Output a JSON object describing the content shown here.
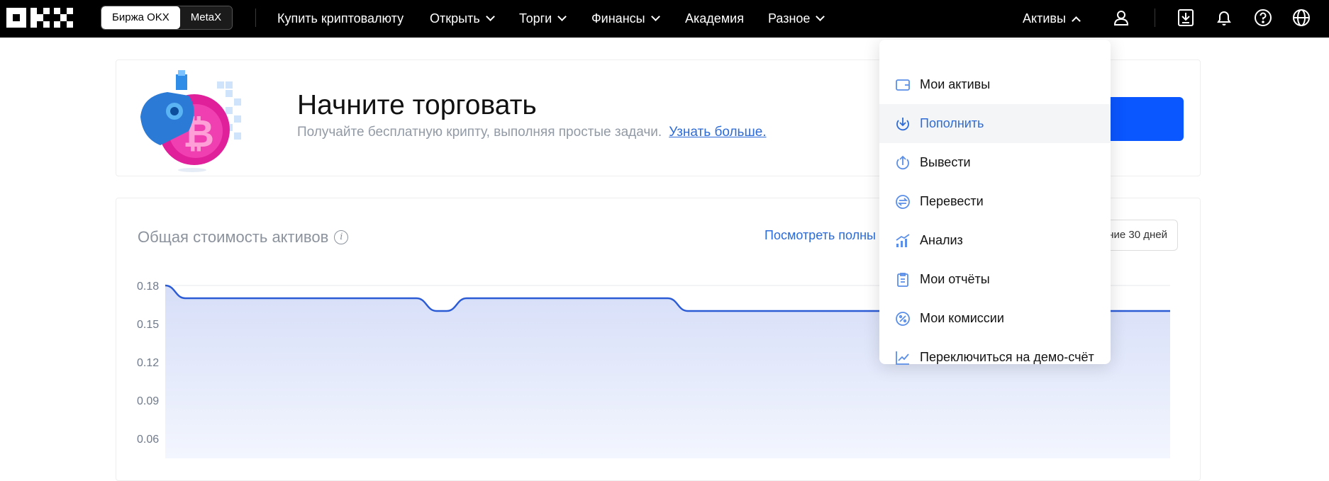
{
  "header": {
    "logo_alt": "OKX",
    "switch": {
      "exchange": "Биржа OKX",
      "metax": "MetaX"
    },
    "nav": [
      {
        "label": "Купить криптовалюту",
        "chevron": false
      },
      {
        "label": "Открыть",
        "chevron": true
      },
      {
        "label": "Торги",
        "chevron": true
      },
      {
        "label": "Финансы",
        "chevron": true
      },
      {
        "label": "Академия",
        "chevron": false
      },
      {
        "label": "Разное",
        "chevron": true
      }
    ],
    "assets_label": "Активы"
  },
  "banner": {
    "title": "Начните торговать",
    "subtitle": "Получайте бесплатную крипту, выполняя простые задачи.",
    "link": "Узнать больше."
  },
  "assets_card": {
    "title": "Общая стоимость активов",
    "view_link": "Посмотреть полны",
    "period": "ние 30 дней"
  },
  "chart_data": {
    "type": "area",
    "y_ticks": [
      "0.18",
      "0.15",
      "0.12",
      "0.09",
      "0.06"
    ],
    "ylim": [
      0.03,
      0.18
    ],
    "x": [
      0,
      2,
      4,
      25,
      27,
      28,
      30,
      50,
      52,
      100
    ],
    "values": [
      0.18,
      0.17,
      0.17,
      0.17,
      0.16,
      0.16,
      0.17,
      0.17,
      0.16,
      0.16
    ],
    "colors": {
      "line": "#2c5bd6",
      "fill_top": "#d6def8",
      "fill_bottom": "#f3f6fe"
    }
  },
  "dropdown": {
    "items": [
      {
        "label": "Мои активы",
        "icon": "wallet-icon",
        "active": false
      },
      {
        "label": "Пополнить",
        "icon": "deposit-icon",
        "active": true
      },
      {
        "label": "Вывести",
        "icon": "withdraw-icon",
        "active": false
      },
      {
        "label": "Перевести",
        "icon": "transfer-icon",
        "active": false
      },
      {
        "label": "Анализ",
        "icon": "analysis-icon",
        "active": false
      },
      {
        "label": "Мои отчёты",
        "icon": "report-icon",
        "active": false
      },
      {
        "label": "Мои комиссии",
        "icon": "fee-icon",
        "active": false
      },
      {
        "label": "Переключиться на демо-счёт",
        "icon": "demo-chart-icon",
        "active": false
      }
    ]
  },
  "colors": {
    "accent": "#2c6bd8",
    "cta": "#0a56ff",
    "topbar": "#000000"
  }
}
